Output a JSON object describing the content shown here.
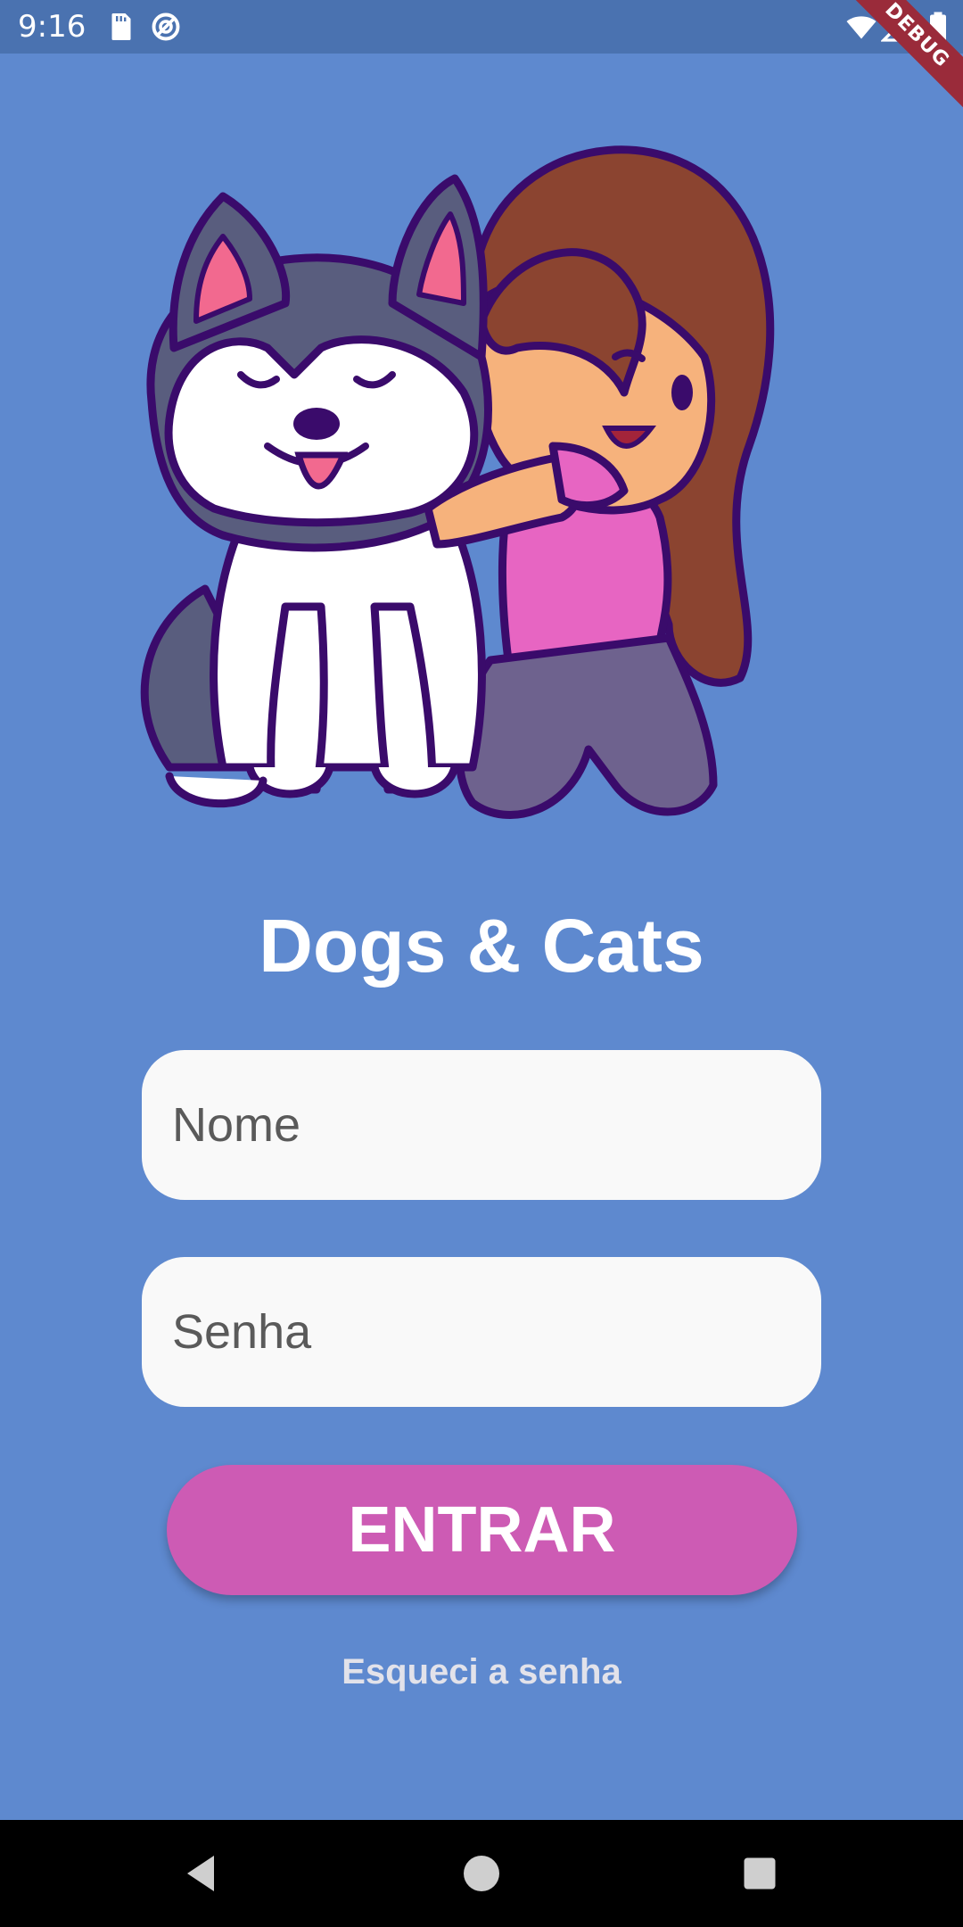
{
  "status_bar": {
    "time": "9:16",
    "icons": [
      "sd-card-icon",
      "sync-icon",
      "wifi-icon",
      "signal-icon",
      "battery-icon"
    ]
  },
  "debug_banner": "DEBUG",
  "app": {
    "title": "Dogs & Cats",
    "illustration": "girl-hugging-husky-dog"
  },
  "form": {
    "name_placeholder": "Nome",
    "password_placeholder": "Senha",
    "submit_label": "ENTRAR",
    "forgot_label": "Esqueci a senha"
  },
  "nav_bar": {
    "icons": [
      "back-icon",
      "home-icon",
      "recents-icon"
    ]
  },
  "colors": {
    "background": "#5e89cf",
    "status_bar": "#4a72b0",
    "button": "#cd5bb4",
    "field": "#f9f9f9"
  }
}
